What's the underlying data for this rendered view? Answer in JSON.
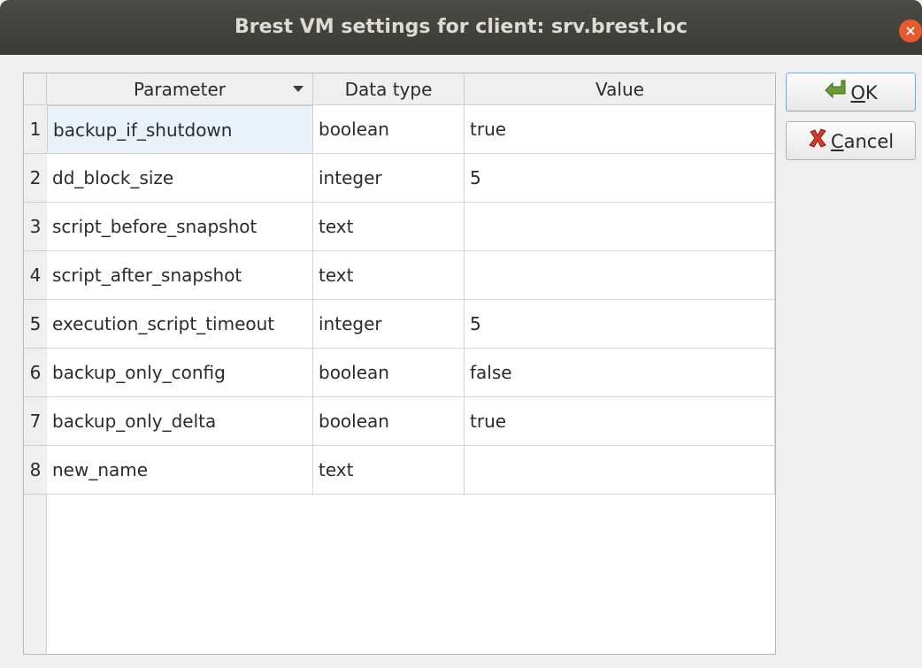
{
  "window": {
    "title": "Brest VM settings for client: srv.brest.loc",
    "close_glyph": "×"
  },
  "table": {
    "columns": [
      "Parameter",
      "Data type",
      "Value"
    ],
    "rows": [
      {
        "num": "1",
        "parameter": "backup_if_shutdown",
        "type": "boolean",
        "value": "true"
      },
      {
        "num": "2",
        "parameter": "dd_block_size",
        "type": "integer",
        "value": "5"
      },
      {
        "num": "3",
        "parameter": "script_before_snapshot",
        "type": "text",
        "value": ""
      },
      {
        "num": "4",
        "parameter": "script_after_snapshot",
        "type": "text",
        "value": ""
      },
      {
        "num": "5",
        "parameter": "execution_script_timeout",
        "type": "integer",
        "value": "5"
      },
      {
        "num": "6",
        "parameter": "backup_only_config",
        "type": "boolean",
        "value": "false"
      },
      {
        "num": "7",
        "parameter": "backup_only_delta",
        "type": "boolean",
        "value": "true"
      },
      {
        "num": "8",
        "parameter": "new_name",
        "type": "text",
        "value": ""
      }
    ],
    "sorted_column": "Parameter",
    "selected_row": "1"
  },
  "buttons": {
    "ok": {
      "mnemonic": "O",
      "rest": "K",
      "icon": "ok-arrow-icon"
    },
    "cancel": {
      "mnemonic": "C",
      "rest": "ancel",
      "icon": "cancel-x-icon"
    }
  },
  "colors": {
    "titlebar": "#3f3f3c",
    "close": "#e65a2e",
    "selection": "#e9f2f9",
    "ok_icon": "#5a8a2c",
    "cancel_icon": "#c0392b"
  }
}
